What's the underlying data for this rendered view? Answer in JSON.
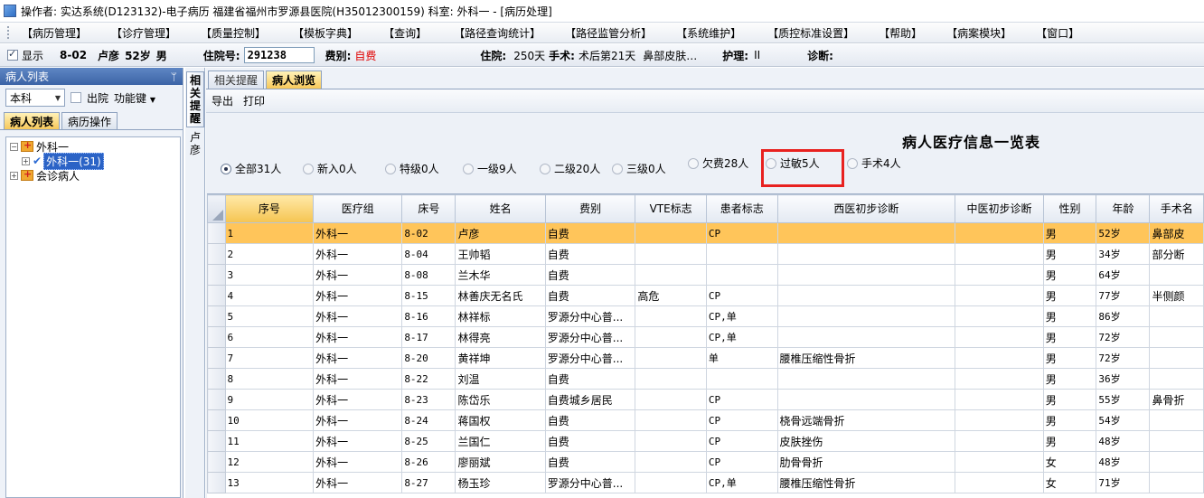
{
  "titlebar": {
    "text": "操作者: 实达系统(D123132)-电子病历  福建省福州市罗源县医院(H35012300159)  科室: 外科一 - [病历处理]"
  },
  "menubar": {
    "items": [
      "【病历管理】",
      "【诊疗管理】",
      "【质量控制】",
      "【模板字典】",
      "【查询】",
      "【路径查询统计】",
      "【路径监管分析】",
      "【系统维护】",
      "【质控标准设置】",
      "【帮助】",
      "【病案模块】",
      "【窗口】"
    ]
  },
  "infobar": {
    "show_label": "显示",
    "bed": "8-02",
    "name": "卢彦",
    "age": "52岁",
    "gender": "男",
    "hosp_no_label": "住院号:",
    "hosp_no": "291238",
    "fee_label": "费别:",
    "fee_value": "自费",
    "stay_label": "住院:",
    "stay_value": "250天",
    "surgery_label": "手术:",
    "surgery_value": "术后第21天",
    "surgery_name": "鼻部皮肤…",
    "nursing_label": "护理:",
    "nursing_value": "II",
    "diagnosis_label": "诊断:",
    "diagnosis_value": ""
  },
  "leftpanel": {
    "title": "病人列表",
    "pin": "ᛘ",
    "dept_select": "本科",
    "discharge_label": "出院",
    "func_label": "功能键",
    "tabs": [
      "病人列表",
      "病历操作"
    ],
    "tree": {
      "root": "外科一",
      "child": "外科一(31)",
      "consult": "会诊病人"
    }
  },
  "vstrip": {
    "tab1": "相关提醒",
    "tab2": "卢彦"
  },
  "main": {
    "tabs": [
      "相关提醒",
      "病人浏览"
    ],
    "toolbar": [
      "导出",
      "打印"
    ],
    "report_title": "病人医疗信息一览表",
    "filters": [
      "全部31人",
      "新入0人",
      "特级0人",
      "一级9人",
      "二级20人",
      "三级0人",
      "欠费28人",
      "过敏5人",
      "手术4人"
    ],
    "columns": [
      "序号",
      "医疗组",
      "床号",
      "姓名",
      "费别",
      "VTE标志",
      "患者标志",
      "西医初步诊断",
      "中医初步诊断",
      "性别",
      "年龄",
      "手术名"
    ],
    "rows": [
      [
        "1",
        "外科一",
        "8-02",
        "卢彦",
        "自费",
        "",
        "CP",
        "",
        "",
        "男",
        "52岁",
        "鼻部皮"
      ],
      [
        "2",
        "外科一",
        "8-04",
        "王帅韬",
        "自费",
        "",
        "",
        "",
        "",
        "男",
        "34岁",
        "部分断"
      ],
      [
        "3",
        "外科一",
        "8-08",
        "兰木华",
        "自费",
        "",
        "",
        "",
        "",
        "男",
        "64岁",
        ""
      ],
      [
        "4",
        "外科一",
        "8-15",
        "林善庆无名氏",
        "自费",
        "高危",
        "CP",
        "",
        "",
        "男",
        "77岁",
        "半侧颜"
      ],
      [
        "5",
        "外科一",
        "8-16",
        "林祥标",
        "罗源分中心普...",
        "",
        "CP,单",
        "",
        "",
        "男",
        "86岁",
        ""
      ],
      [
        "6",
        "外科一",
        "8-17",
        "林得亮",
        "罗源分中心普...",
        "",
        "CP,单",
        "",
        "",
        "男",
        "72岁",
        ""
      ],
      [
        "7",
        "外科一",
        "8-20",
        "黄祥坤",
        "罗源分中心普...",
        "",
        "单",
        "腰椎压缩性骨折",
        "",
        "男",
        "72岁",
        ""
      ],
      [
        "8",
        "外科一",
        "8-22",
        "刘温",
        "自费",
        "",
        "",
        "",
        "",
        "男",
        "36岁",
        ""
      ],
      [
        "9",
        "外科一",
        "8-23",
        "陈岱乐",
        "自费城乡居民",
        "",
        "CP",
        "",
        "",
        "男",
        "55岁",
        "鼻骨折"
      ],
      [
        "10",
        "外科一",
        "8-24",
        "蒋国权",
        "自费",
        "",
        "CP",
        "桡骨远端骨折",
        "",
        "男",
        "54岁",
        ""
      ],
      [
        "11",
        "外科一",
        "8-25",
        "兰国仁",
        "自费",
        "",
        "CP",
        "皮肤挫伤",
        "",
        "男",
        "48岁",
        ""
      ],
      [
        "12",
        "外科一",
        "8-26",
        "廖丽斌",
        "自费",
        "",
        "CP",
        "肋骨骨折",
        "",
        "女",
        "48岁",
        ""
      ],
      [
        "13",
        "外科一",
        "8-27",
        "杨玉珍",
        "罗源分中心普...",
        "",
        "CP,单",
        "腰椎压缩性骨折",
        "",
        "女",
        "71岁",
        ""
      ]
    ]
  }
}
